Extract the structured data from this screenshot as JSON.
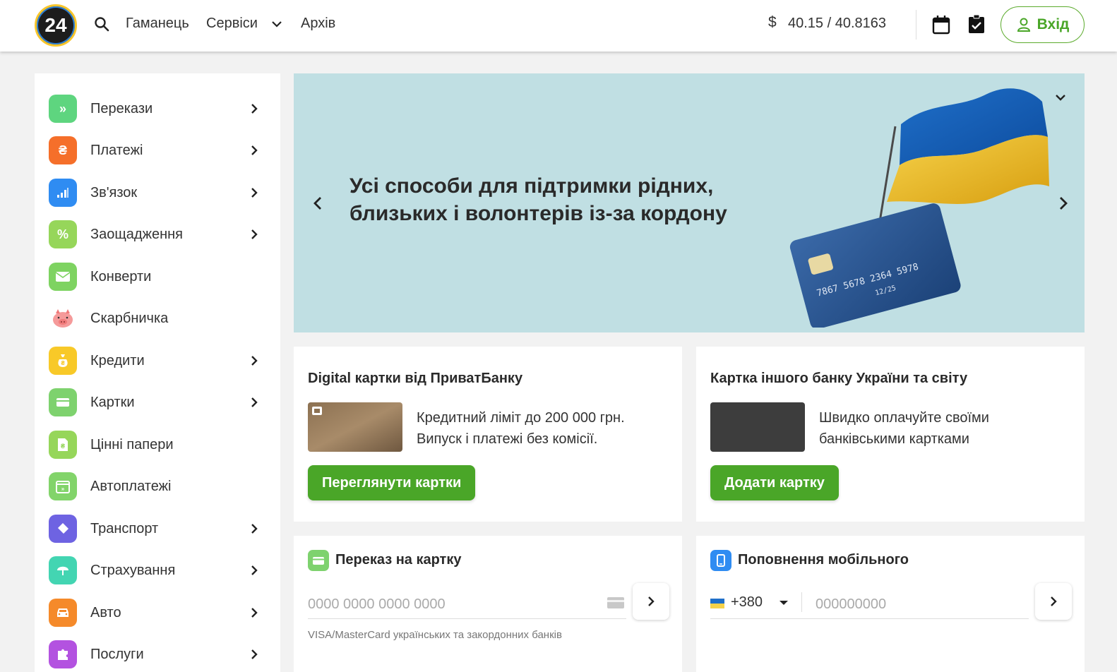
{
  "header": {
    "logo_text": "24",
    "nav": [
      "Гаманець",
      "Сервіси",
      "Архів"
    ],
    "currency_symbol": "$",
    "rate": "40.15 / 40.8163",
    "login_label": "Вхід",
    "accent_color": "#4aa628"
  },
  "sidebar": {
    "items": [
      {
        "label": "Перекази",
        "icon": "double-chevron-icon",
        "color": "#5ed57f",
        "has_arrow": true
      },
      {
        "label": "Платежі",
        "icon": "hryvnia-icon",
        "color": "#f56f2a",
        "has_arrow": true
      },
      {
        "label": "Зв'язок",
        "icon": "signal-icon",
        "color": "#2f8cf2",
        "has_arrow": true
      },
      {
        "label": "Заощадження",
        "icon": "percent-icon",
        "color": "#96d65a",
        "has_arrow": true
      },
      {
        "label": "Конверти",
        "icon": "envelope-icon",
        "color": "#7ed361",
        "has_arrow": false
      },
      {
        "label": "Скарбничка",
        "icon": "piggy-bank-icon",
        "color": "#ffffff",
        "has_arrow": false
      },
      {
        "label": "Кредити",
        "icon": "money-bag-icon",
        "color": "#f8c928",
        "has_arrow": true
      },
      {
        "label": "Картки",
        "icon": "card-icon",
        "color": "#7ed26e",
        "has_arrow": true
      },
      {
        "label": "Цінні папери",
        "icon": "securities-icon",
        "color": "#96d65a",
        "has_arrow": false
      },
      {
        "label": "Автоплатежі",
        "icon": "calendar-icon",
        "color": "#82d46a",
        "has_arrow": false
      },
      {
        "label": "Транспорт",
        "icon": "ticket-icon",
        "color": "#6e63e2",
        "has_arrow": true
      },
      {
        "label": "Страхування",
        "icon": "umbrella-icon",
        "color": "#43d5b2",
        "has_arrow": true
      },
      {
        "label": "Авто",
        "icon": "car-icon",
        "color": "#f58a2a",
        "has_arrow": true
      },
      {
        "label": "Послуги",
        "icon": "puzzle-icon",
        "color": "#b352e0",
        "has_arrow": true
      }
    ]
  },
  "banner": {
    "title_line1": "Усі способи для підтримки рідних,",
    "title_line2": "близьких і волонтерів із-за кордону",
    "card_number": "7867 5678 2364 5978",
    "card_expiry": "12/25"
  },
  "promo": {
    "digital": {
      "title": "Digital картки від ПриватБанку",
      "text_line1": "Кредитний ліміт до 200 000 грн.",
      "text_line2": "Випуск і платежі без комісії.",
      "button": "Переглянути картки"
    },
    "other_bank": {
      "title": "Картка іншого банку України та світу",
      "text_line1": "Швидко оплачуйте своїми",
      "text_line2": "банківськими картками",
      "button": "Додати картку"
    }
  },
  "transfer": {
    "title": "Переказ на картку",
    "placeholder": "0000 0000 0000 0000",
    "hint": "VISA/MasterCard українських та закордонних банків"
  },
  "topup": {
    "title": "Поповнення мобільного",
    "country_code": "+380",
    "placeholder": "000000000"
  }
}
